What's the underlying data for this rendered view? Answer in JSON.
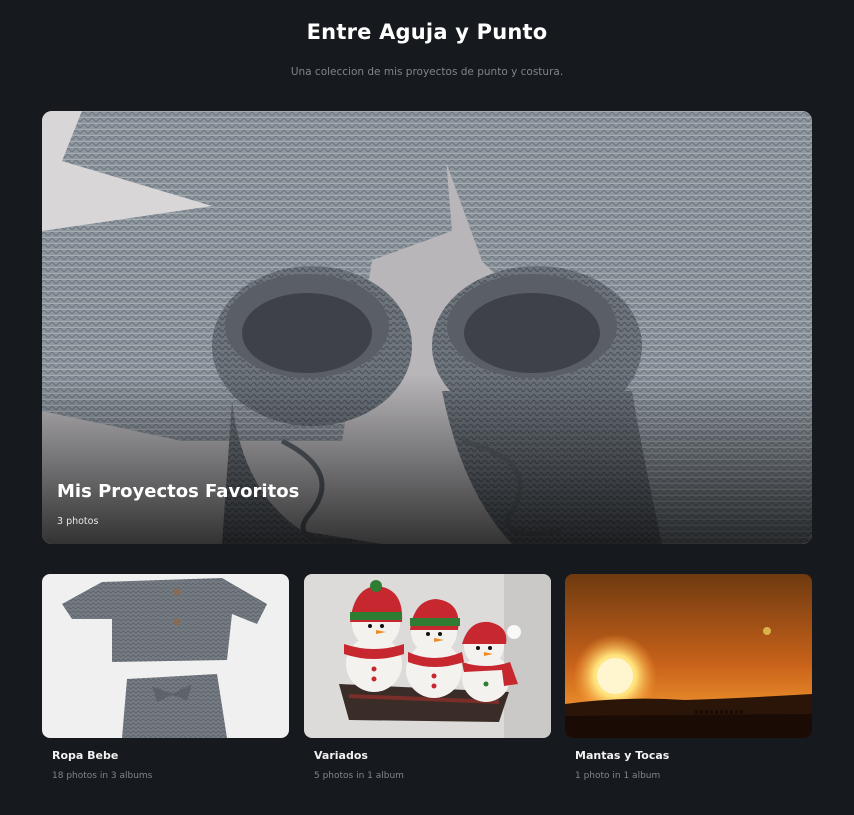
{
  "site": {
    "title": "Entre Aguja y Punto",
    "subtitle": "Una coleccion de mis proyectos de punto y costura."
  },
  "featured": {
    "title": "Mis Proyectos Favoritos",
    "count": "3 photos"
  },
  "albums": [
    {
      "title": "Ropa Bebe",
      "meta": "18 photos in 3 albums"
    },
    {
      "title": "Variados",
      "meta": "5 photos in 1 album"
    },
    {
      "title": "Mantas y Tocas",
      "meta": "1 photo in 1 album"
    }
  ]
}
